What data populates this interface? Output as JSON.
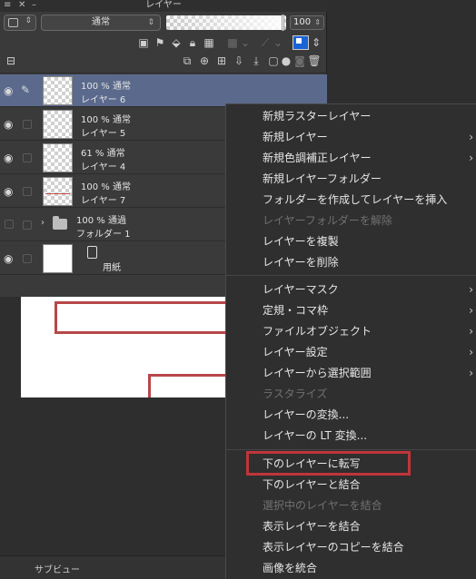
{
  "panel": {
    "title": "レイヤー",
    "blend_mode": "通常",
    "opacity_value": "100",
    "opacity_fraction": 0.98
  },
  "layers": [
    {
      "opacity_mode": "100 % 通常",
      "name": "レイヤー 6",
      "selected": true
    },
    {
      "opacity_mode": "100 % 通常",
      "name": "レイヤー 5",
      "selected": false
    },
    {
      "opacity_mode": "61 % 通常",
      "name": "レイヤー 4",
      "selected": false
    },
    {
      "opacity_mode": "100 % 通常",
      "name": "レイヤー 7",
      "selected": false
    },
    {
      "opacity_mode": "100 % 通過",
      "name": "フォルダー 1",
      "selected": false
    },
    {
      "opacity_mode": "",
      "name": "用紙",
      "selected": false
    }
  ],
  "menu": {
    "items": [
      {
        "label": "新規ラスターレイヤー",
        "submenu": false,
        "disabled": false
      },
      {
        "label": "新規レイヤー",
        "submenu": true,
        "disabled": false
      },
      {
        "label": "新規色調補正レイヤー",
        "submenu": true,
        "disabled": false
      },
      {
        "label": "新規レイヤーフォルダー",
        "submenu": false,
        "disabled": false
      },
      {
        "label": "フォルダーを作成してレイヤーを挿入",
        "submenu": false,
        "disabled": false
      },
      {
        "label": "レイヤーフォルダーを解除",
        "submenu": false,
        "disabled": true
      },
      {
        "label": "レイヤーを複製",
        "submenu": false,
        "disabled": false
      },
      {
        "label": "レイヤーを削除",
        "submenu": false,
        "disabled": false
      },
      {
        "label": "レイヤーマスク",
        "submenu": true,
        "disabled": false
      },
      {
        "label": "定規・コマ枠",
        "submenu": true,
        "disabled": false
      },
      {
        "label": "ファイルオブジェクト",
        "submenu": true,
        "disabled": false
      },
      {
        "label": "レイヤー設定",
        "submenu": true,
        "disabled": false
      },
      {
        "label": "レイヤーから選択範囲",
        "submenu": true,
        "disabled": false
      },
      {
        "label": "ラスタライズ",
        "submenu": false,
        "disabled": true
      },
      {
        "label": "レイヤーの変換...",
        "submenu": false,
        "disabled": false
      },
      {
        "label": "レイヤーの LT 変換...",
        "submenu": false,
        "disabled": false
      },
      {
        "label": "下のレイヤーに転写",
        "submenu": false,
        "disabled": false
      },
      {
        "label": "下のレイヤーと結合",
        "submenu": false,
        "disabled": false
      },
      {
        "label": "選択中のレイヤーを結合",
        "submenu": false,
        "disabled": true
      },
      {
        "label": "表示レイヤーを結合",
        "submenu": false,
        "disabled": false
      },
      {
        "label": "表示レイヤーのコピーを結合",
        "submenu": false,
        "disabled": false
      },
      {
        "label": "画像を統合",
        "submenu": false,
        "disabled": false
      }
    ]
  },
  "subview": {
    "label": "サブビュー"
  },
  "colors": {
    "selected_row": "#5b6a8c",
    "highlight": "#c0353a",
    "canvas_lines": "#b8474a"
  }
}
